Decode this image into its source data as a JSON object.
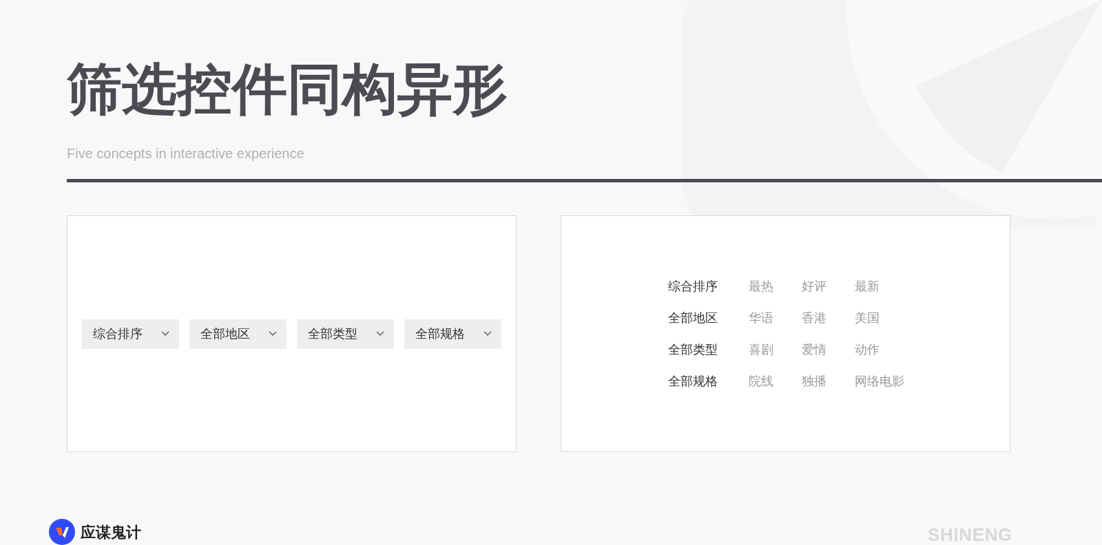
{
  "title": "筛选控件同构异形",
  "subtitle": "Five concepts in interactive experience",
  "dropdowns": [
    {
      "label": "综合排序"
    },
    {
      "label": "全部地区"
    },
    {
      "label": "全部类型"
    },
    {
      "label": "全部规格"
    }
  ],
  "filter_rows": [
    {
      "label": "综合排序",
      "options": [
        "最热",
        "好评",
        "最新"
      ]
    },
    {
      "label": "全部地区",
      "options": [
        "华语",
        "香港",
        "美国"
      ]
    },
    {
      "label": "全部类型",
      "options": [
        "喜剧",
        "爱情",
        "动作"
      ]
    },
    {
      "label": "全部规格",
      "options": [
        "院线",
        "独播",
        "网络电影"
      ]
    }
  ],
  "footer": {
    "brand": "应谋鬼计",
    "mark": "SHINENG"
  }
}
